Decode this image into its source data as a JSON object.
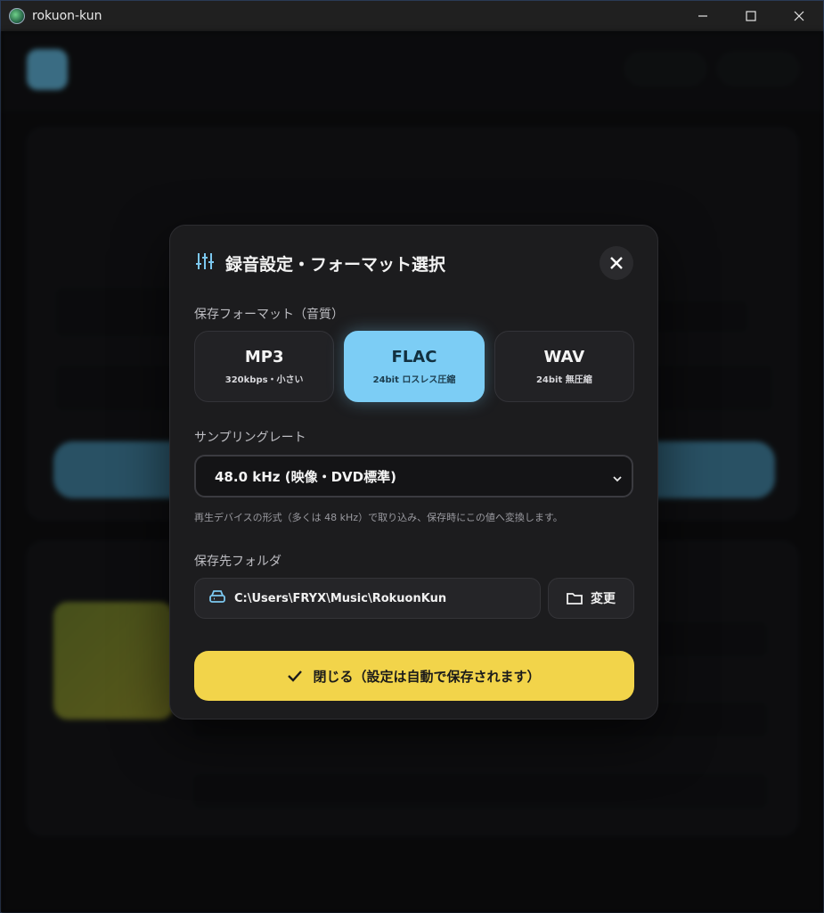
{
  "window": {
    "title": "rokuon-kun",
    "icons": {
      "app": "app-globe-icon",
      "minimize": "minimize-icon",
      "maximize": "maximize-icon",
      "close": "close-icon"
    }
  },
  "modal": {
    "title": "録音設定・フォーマット選択",
    "title_icon": "sliders-icon",
    "format_section_label": "保存フォーマット（音質）",
    "formats": [
      {
        "name": "MP3",
        "desc": "320kbps・小さい",
        "selected": false
      },
      {
        "name": "FLAC",
        "desc": "24bit ロスレス圧縮",
        "selected": true
      },
      {
        "name": "WAV",
        "desc": "24bit 無圧縮",
        "selected": false
      }
    ],
    "sample_rate_label": "サンプリングレート",
    "sample_rate_value": "48.0 kHz (映像・DVD標準)",
    "sample_rate_hint": "再生デバイスの形式（多くは 48 kHz）で取り込み、保存時にこの値へ変換します。",
    "folder_label": "保存先フォルダ",
    "folder_path": "C:\\Users\\FRYX\\Music\\RokuonKun",
    "change_button": "変更",
    "close_button": "閉じる（設定は自動で保存されます）"
  },
  "colors": {
    "accent_blue": "#7ccdf5",
    "accent_yellow": "#f2d44a",
    "modal_bg": "#1c1c1e"
  }
}
